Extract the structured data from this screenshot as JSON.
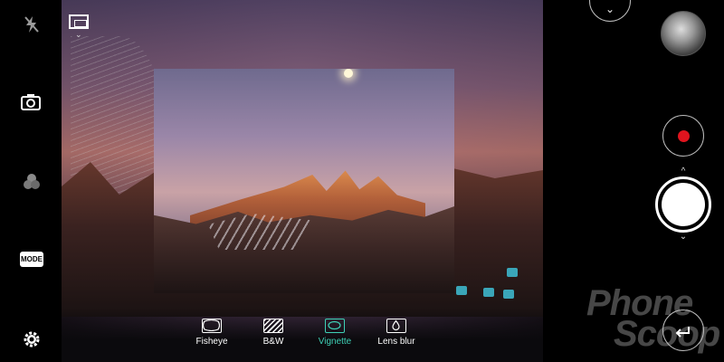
{
  "left_toolbar": {
    "flash": {
      "icon": "flash-off-icon"
    },
    "switch_camera": {
      "icon": "switch-camera-icon"
    },
    "filters": {
      "icon": "filters-icon"
    },
    "mode": {
      "label": "MODE"
    },
    "settings": {
      "icon": "gear-icon"
    }
  },
  "top_bar": {
    "aspect_ratio": {
      "icon": "aspect-ratio-icon"
    },
    "collapse": {
      "icon": "chevron-down-icon",
      "glyph": "⌄"
    }
  },
  "right_bar": {
    "gallery": {
      "icon": "gallery-thumbnail"
    },
    "record": {
      "icon": "record-icon",
      "color": "#e0141e"
    },
    "shutter": {
      "icon": "shutter-icon"
    },
    "caret_up": "^",
    "caret_down": "⌄",
    "back": {
      "icon": "back-arrow-icon"
    }
  },
  "effects": {
    "selected_color": "#3fd0b6",
    "items": [
      {
        "label": "Fisheye",
        "icon": "fisheye-icon",
        "selected": false
      },
      {
        "label": "B&W",
        "icon": "bw-icon",
        "selected": false
      },
      {
        "label": "Vignette",
        "icon": "vignette-icon",
        "selected": true
      },
      {
        "label": "Lens blur",
        "icon": "lens-blur-icon",
        "selected": false
      }
    ]
  },
  "watermark": {
    "line1": "Phone",
    "line2": "Scoop"
  }
}
